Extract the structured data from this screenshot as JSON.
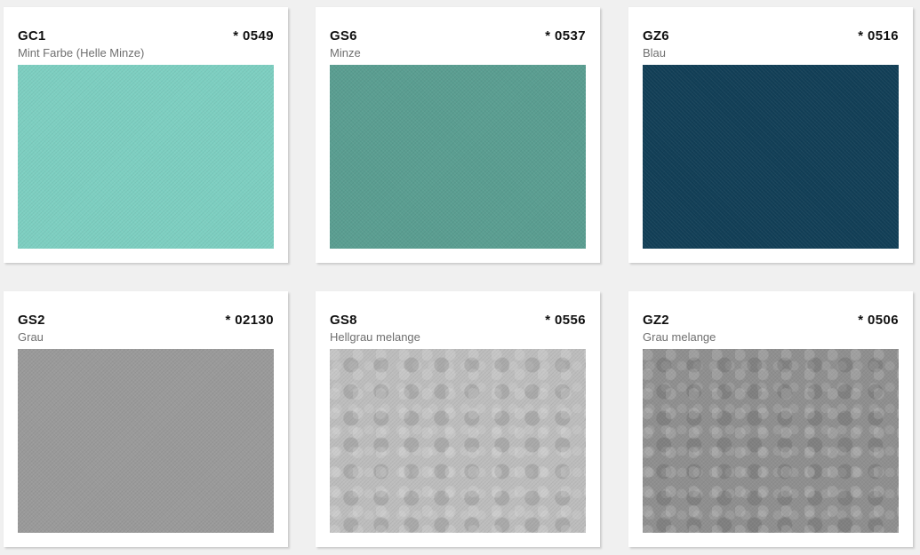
{
  "swatches": [
    {
      "code": "GC1",
      "number": "* 0549",
      "name": "Mint Farbe (Helle Minze)",
      "color": "#7dcfc1",
      "variant": "plain"
    },
    {
      "code": "GS6",
      "number": "* 0537",
      "name": "Minze",
      "color": "#5a9e91",
      "variant": "plain"
    },
    {
      "code": "GZ6",
      "number": "* 0516",
      "name": "Blau",
      "color": "#123f57",
      "variant": "plain"
    },
    {
      "code": "GS2",
      "number": "* 02130",
      "name": "Grau",
      "color": "#9a9a9a",
      "variant": "plain"
    },
    {
      "code": "GS8",
      "number": "* 0556",
      "name": "Hellgrau melange",
      "color": "#bdbdbd",
      "variant": "melange"
    },
    {
      "code": "GZ2",
      "number": "* 0506",
      "name": "Grau melange",
      "color": "#8f8f8f",
      "variant": "melange"
    }
  ]
}
